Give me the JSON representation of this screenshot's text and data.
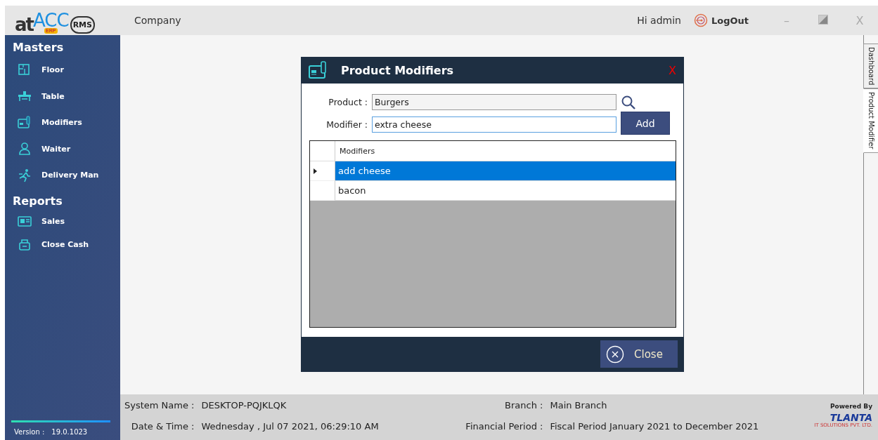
{
  "logo": {
    "brand": "at",
    "brand_accent": "ACC",
    "badge": "ERP",
    "product": "RMS"
  },
  "header": {
    "title": "Company",
    "greeting": "Hi admin",
    "logout": "LogOut",
    "minimize": "–",
    "close": "X"
  },
  "sidebar": {
    "sections": [
      {
        "title": "Masters",
        "items": [
          {
            "label": "Floor"
          },
          {
            "label": "Table"
          },
          {
            "label": "Modifiers"
          },
          {
            "label": "Waiter"
          },
          {
            "label": "Delivery Man"
          }
        ]
      },
      {
        "title": "Reports",
        "items": [
          {
            "label": "Sales"
          },
          {
            "label": "Close Cash"
          }
        ]
      }
    ],
    "version_label": "Version :",
    "version": "19.0.1023"
  },
  "side_tabs": [
    {
      "label": "Dashboard",
      "selected": false
    },
    {
      "label": "Product Modifier",
      "selected": true
    }
  ],
  "dialog": {
    "title": "Product Modifiers",
    "close": "X",
    "fields": [
      {
        "label": "Product :",
        "value": "Burgers",
        "readonly": true
      },
      {
        "label": "Modifier :",
        "value": "extra cheese",
        "readonly": false
      }
    ],
    "add_button": "Add",
    "table": {
      "columns": [
        "Modifiers"
      ],
      "rows": [
        {
          "cells": [
            "add cheese"
          ],
          "selected": true
        },
        {
          "cells": [
            "bacon"
          ],
          "selected": false
        }
      ]
    },
    "close_button": "Close"
  },
  "status_bar": {
    "items": [
      {
        "label": "System Name :",
        "value": "DESKTOP-PQJKLQK"
      },
      {
        "label": "Branch :",
        "value": "Main Branch"
      },
      {
        "label": "Date & Time :",
        "value": "Wednesday , Jul 07 2021, 06:29:10 AM"
      },
      {
        "label": "Financial Period :",
        "value": "Fiscal Period January 2021 to December 2021"
      }
    ],
    "powered_by": "Powered By",
    "vendor": "TLANTA",
    "vendor_tagline": "IT SOLUTIONS PVT. LTD."
  }
}
